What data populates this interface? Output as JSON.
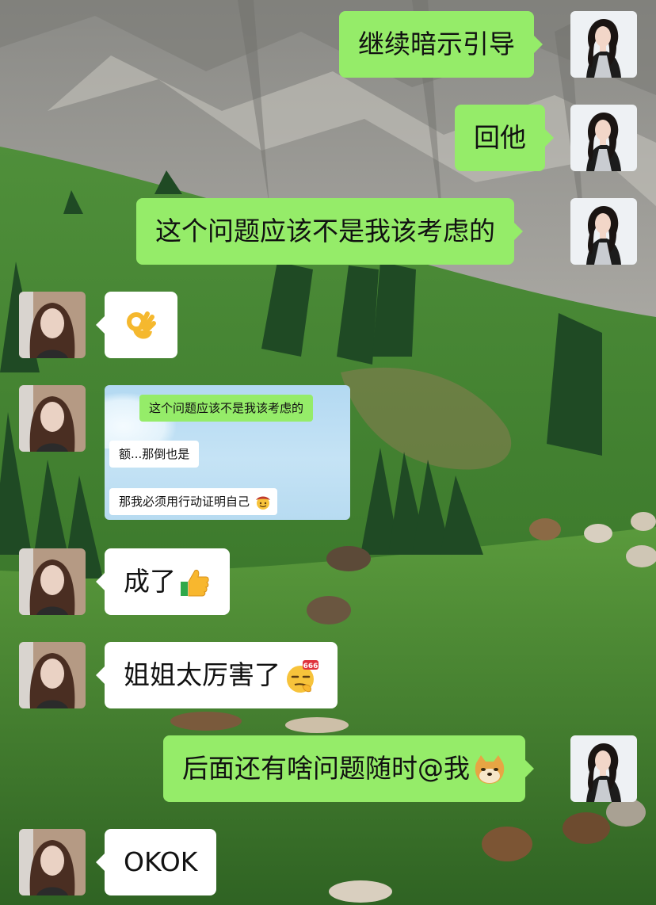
{
  "messages": {
    "m1": {
      "text": "继续暗示引导"
    },
    "m2": {
      "text": "回他"
    },
    "m3": {
      "text": "这个问题应该不是我该考虑的"
    },
    "m4": {
      "emoji": "ok-hand-emoji"
    },
    "m5": {
      "screenshot": {
        "q": "这个问题应该不是我该考虑的",
        "a1": "额...那倒也是",
        "a2": "那我必须用行动证明自己"
      }
    },
    "m6": {
      "text": "成了"
    },
    "m7": {
      "text": "姐姐太厉害了"
    },
    "m8": {
      "text": "后面还有啥问题随时@我"
    },
    "m9": {
      "text": "OKOK"
    }
  },
  "colors": {
    "sent_bubble": "#95ec69",
    "received_bubble": "#ffffff"
  },
  "icons": [
    "ok-hand-emoji",
    "thumbs-up-emoji",
    "666-emoji",
    "doge-emoji",
    "cowboy-emoji"
  ]
}
